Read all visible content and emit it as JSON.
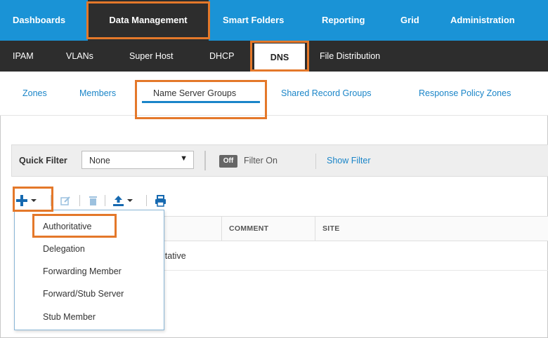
{
  "top_nav": {
    "items": [
      "Dashboards",
      "Data Management",
      "Smart Folders",
      "Reporting",
      "Grid",
      "Administration"
    ],
    "active": "Data Management"
  },
  "sub_nav": {
    "items": [
      "IPAM",
      "VLANs",
      "Super Host",
      "DHCP",
      "DNS",
      "File Distribution"
    ],
    "active": "DNS"
  },
  "tabs": {
    "items": [
      "Zones",
      "Members",
      "Name Server Groups",
      "Shared Record Groups",
      "Response Policy Zones"
    ],
    "active": "Name Server Groups"
  },
  "filter": {
    "quick_filter_label": "Quick Filter",
    "quick_filter_value": "None",
    "toggle_label": "Off",
    "filter_on_label": "Filter On",
    "show_filter_label": "Show Filter"
  },
  "toolbar": {
    "icons": [
      "add-icon",
      "dropdown-caret-icon",
      "edit-icon",
      "delete-icon",
      "export-icon",
      "dropdown-caret-icon",
      "print-icon"
    ]
  },
  "table": {
    "columns": [
      "COMMENT",
      "SITE"
    ],
    "row_partial_text": "itative"
  },
  "add_menu": {
    "items": [
      "Authoritative",
      "Delegation",
      "Forwarding Member",
      "Forward/Stub Server",
      "Stub Member"
    ],
    "highlighted": "Authoritative"
  },
  "colors": {
    "nav_blue": "#1a93d6",
    "dark_bar": "#2d2d2d",
    "link_blue": "#1a85c8",
    "highlight_orange": "#e4782a"
  }
}
